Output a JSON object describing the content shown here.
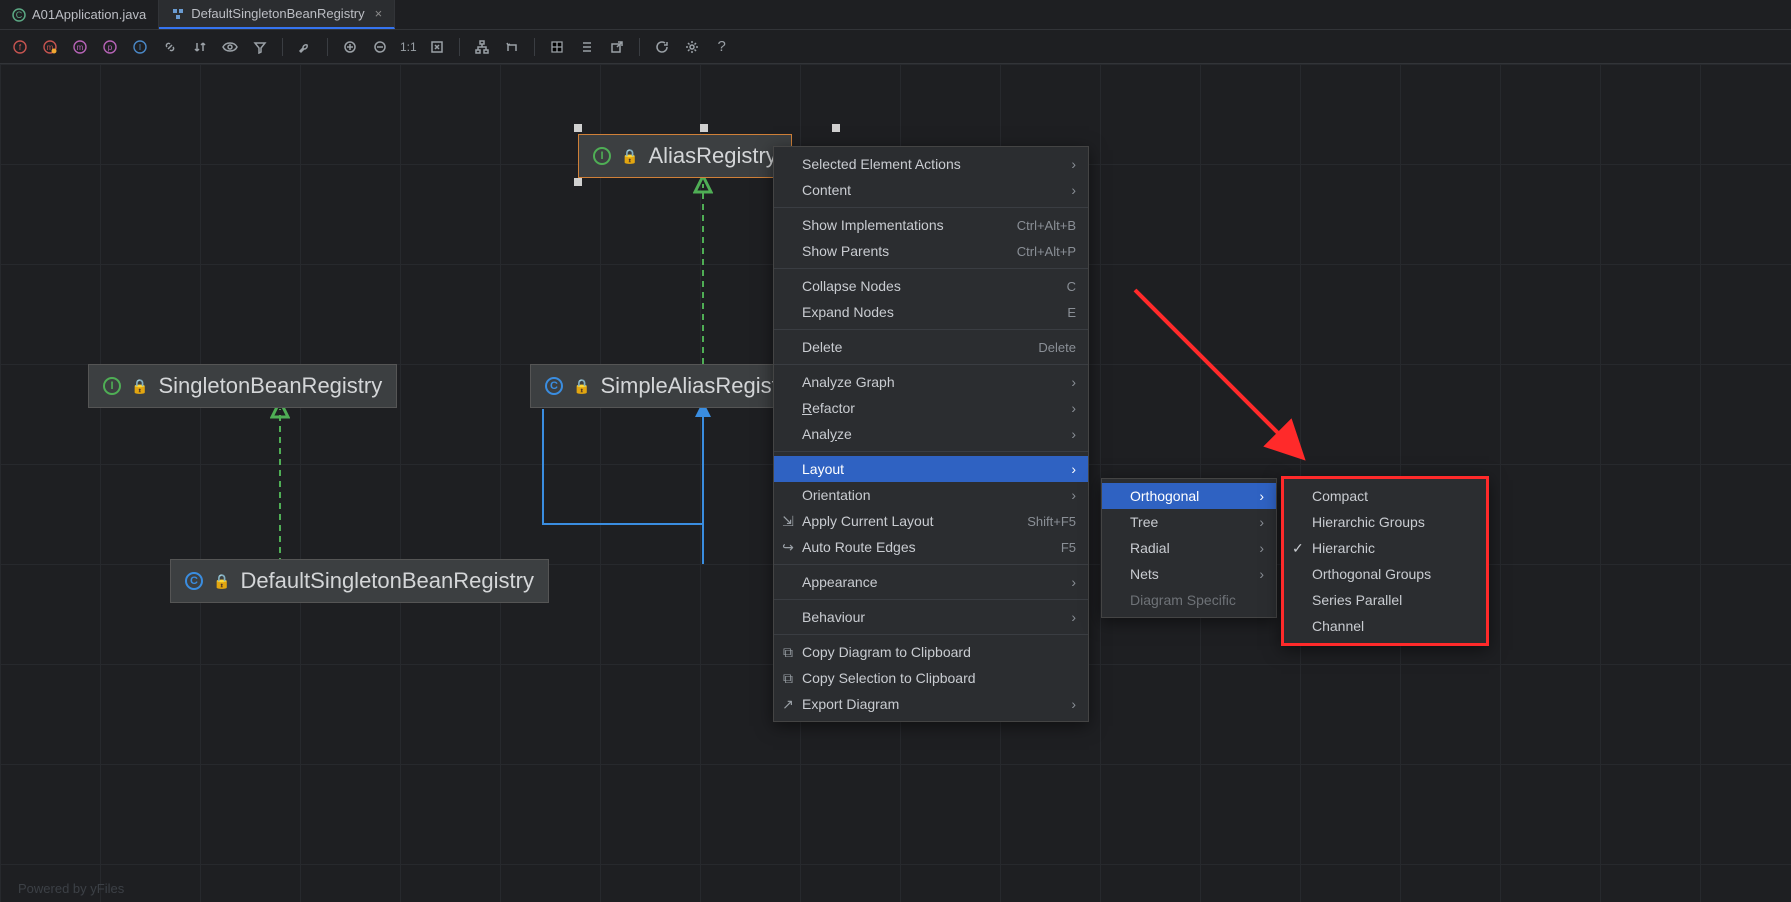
{
  "tabs": [
    {
      "label": "A01Application.java",
      "icon": "class"
    },
    {
      "label": "DefaultSingletonBeanRegistry",
      "icon": "diagram"
    }
  ],
  "toolbar": {
    "btns": [
      "f",
      "m",
      "m2",
      "p",
      "i",
      "link",
      "layout",
      "eye",
      "filter",
      "tools",
      "plus",
      "minus",
      "one",
      "fit",
      "tree",
      "org",
      "layers",
      "grid",
      "export",
      "refresh",
      "gear",
      "help"
    ],
    "one_label": "1:1"
  },
  "nodes": {
    "alias": {
      "label": "AliasRegistry",
      "type": "I"
    },
    "singleton": {
      "label": "SingletonBeanRegistry",
      "type": "I"
    },
    "simple": {
      "label": "SimpleAliasRegistry",
      "type": "C"
    },
    "default": {
      "label": "DefaultSingletonBeanRegistry",
      "type": "C"
    }
  },
  "context_menu": {
    "groups": [
      [
        {
          "label": "Selected Element Actions",
          "submenu": true
        },
        {
          "label": "Content",
          "submenu": true
        }
      ],
      [
        {
          "label": "Show Implementations",
          "shortcut": "Ctrl+Alt+B"
        },
        {
          "label": "Show Parents",
          "shortcut": "Ctrl+Alt+P"
        }
      ],
      [
        {
          "label": "Collapse Nodes",
          "shortcut": "C"
        },
        {
          "label": "Expand Nodes",
          "shortcut": "E"
        }
      ],
      [
        {
          "label": "Delete",
          "shortcut": "Delete"
        }
      ],
      [
        {
          "label": "Analyze Graph",
          "submenu": true
        },
        {
          "label_html": "Refactor",
          "underline": 0,
          "submenu": true
        },
        {
          "label_html": "Analyze",
          "underline": 4,
          "submenu": true
        }
      ],
      [
        {
          "label": "Layout",
          "submenu": true,
          "highlighted": true
        },
        {
          "label": "Orientation",
          "submenu": true
        },
        {
          "label": "Apply Current Layout",
          "shortcut": "Shift+F5",
          "icon": "apply"
        },
        {
          "label": "Auto Route Edges",
          "shortcut": "F5",
          "icon": "route"
        }
      ],
      [
        {
          "label": "Appearance",
          "submenu": true
        }
      ],
      [
        {
          "label": "Behaviour",
          "submenu": true
        }
      ],
      [
        {
          "label": "Copy Diagram to Clipboard",
          "icon": "copy"
        },
        {
          "label": "Copy Selection to Clipboard",
          "icon": "copysel"
        },
        {
          "label": "Export Diagram",
          "icon": "export",
          "submenu": true
        }
      ]
    ]
  },
  "submenu_layout": [
    {
      "label": "Orthogonal",
      "submenu": true,
      "highlighted": true
    },
    {
      "label": "Tree",
      "submenu": true
    },
    {
      "label": "Radial",
      "submenu": true
    },
    {
      "label": "Nets",
      "submenu": true
    },
    {
      "label": "Diagram Specific",
      "disabled": true
    }
  ],
  "submenu_orthogonal": [
    {
      "label": "Compact"
    },
    {
      "label": "Hierarchic Groups"
    },
    {
      "label": "Hierarchic",
      "checked": true
    },
    {
      "label": "Orthogonal Groups"
    },
    {
      "label": "Series Parallel"
    },
    {
      "label": "Channel"
    }
  ],
  "watermark": "Powered by yFiles"
}
